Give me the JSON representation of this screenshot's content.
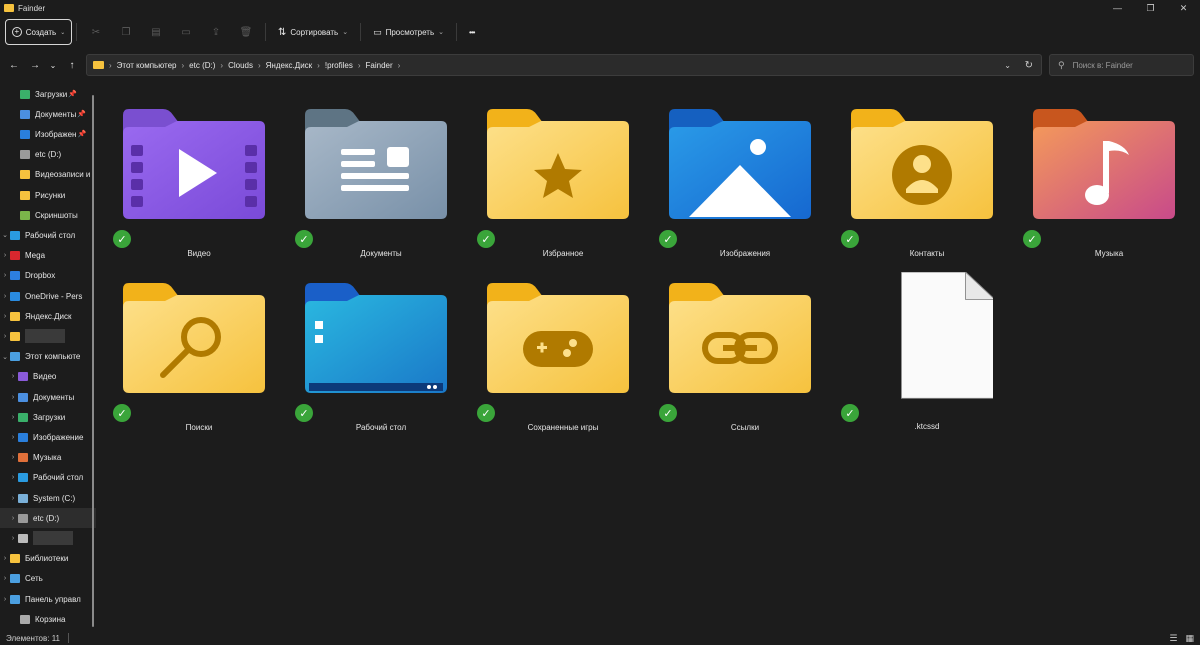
{
  "window": {
    "title": "Fainder",
    "controls": [
      "—",
      "❐",
      "✕"
    ]
  },
  "toolbar": {
    "new_label": "Создать",
    "sort_label": "Сортировать",
    "view_label": "Просмотреть",
    "more_label": "•••"
  },
  "address": {
    "crumbs": [
      "Этот компьютер",
      "etc (D:)",
      "Clouds",
      "Яндекс.Диск",
      "!profiles",
      "Fainder"
    ]
  },
  "search": {
    "placeholder": "Поиск в: Fainder"
  },
  "sidebar": {
    "items": [
      {
        "label": "Загрузки",
        "pinned": true,
        "color": "#3ab06a"
      },
      {
        "label": "Документы",
        "pinned": true,
        "color": "#4b8fe0"
      },
      {
        "label": "Изображен",
        "pinned": true,
        "color": "#2a7fdc"
      },
      {
        "label": "etc (D:)",
        "pinned": false,
        "color": "#9a9a9a"
      },
      {
        "label": "Видеозаписи и",
        "pinned": false,
        "color": "#f6c23e"
      },
      {
        "label": "Рисунки",
        "pinned": false,
        "color": "#f6c23e"
      },
      {
        "label": "Скриншоты",
        "pinned": false,
        "color": "#7ab64a"
      },
      {
        "label": "Рабочий стол",
        "pinned": false,
        "color": "#2a9be0",
        "expanded": true
      },
      {
        "label": "Mega",
        "pinned": false,
        "color": "#d9272e"
      },
      {
        "label": "Dropbox",
        "pinned": false,
        "color": "#2d7fe0"
      },
      {
        "label": "OneDrive - Pers",
        "pinned": false,
        "color": "#2a8be0"
      },
      {
        "label": "Яндекс.Диск",
        "pinned": false,
        "color": "#f6c23e"
      },
      {
        "label": "",
        "pinned": false,
        "color": "#f6c23e",
        "blurred": true
      },
      {
        "label": "Этот компьюте",
        "pinned": false,
        "color": "#4b9fe0",
        "expanded": true
      },
      {
        "label": "Видео",
        "pinned": false,
        "color": "#8a5ad9"
      },
      {
        "label": "Документы",
        "pinned": false,
        "color": "#4b8fe0"
      },
      {
        "label": "Загрузки",
        "pinned": false,
        "color": "#3ab06a"
      },
      {
        "label": "Изображение",
        "pinned": false,
        "color": "#2a7fdc"
      },
      {
        "label": "Музыка",
        "pinned": false,
        "color": "#e0703a"
      },
      {
        "label": "Рабочий стол",
        "pinned": false,
        "color": "#2a9be0"
      },
      {
        "label": "System (C:)",
        "pinned": false,
        "color": "#7ab0d8"
      },
      {
        "label": "etc (D:)",
        "pinned": false,
        "color": "#9a9a9a",
        "selected": true
      },
      {
        "label": "",
        "pinned": false,
        "color": "#bbbbbb",
        "blurred": true
      },
      {
        "label": "Библиотеки",
        "pinned": false,
        "color": "#f6c23e"
      },
      {
        "label": "Сеть",
        "pinned": false,
        "color": "#4b9fe0"
      },
      {
        "label": "Панель управл",
        "pinned": false,
        "color": "#4b9fe0"
      },
      {
        "label": "Корзина",
        "pinned": false,
        "color": "#aaaaaa"
      }
    ]
  },
  "files": [
    {
      "name": "Видео",
      "type": "video-folder"
    },
    {
      "name": "Документы",
      "type": "documents-folder"
    },
    {
      "name": "Избранное",
      "type": "favorites-folder"
    },
    {
      "name": "Изображения",
      "type": "pictures-folder"
    },
    {
      "name": "Контакты",
      "type": "contacts-folder"
    },
    {
      "name": "Музыка",
      "type": "music-folder"
    },
    {
      "name": "Поиски",
      "type": "searches-folder"
    },
    {
      "name": "Рабочий стол",
      "type": "desktop-folder"
    },
    {
      "name": "Сохраненные игры",
      "type": "games-folder"
    },
    {
      "name": "Ссылки",
      "type": "links-folder"
    },
    {
      "name": ".ktcssd",
      "type": "file"
    }
  ],
  "status": {
    "count_label": "Элементов: 11"
  },
  "colors": {
    "sync_check": "#3aa53a",
    "folder_yellow": "#f6c23e"
  }
}
